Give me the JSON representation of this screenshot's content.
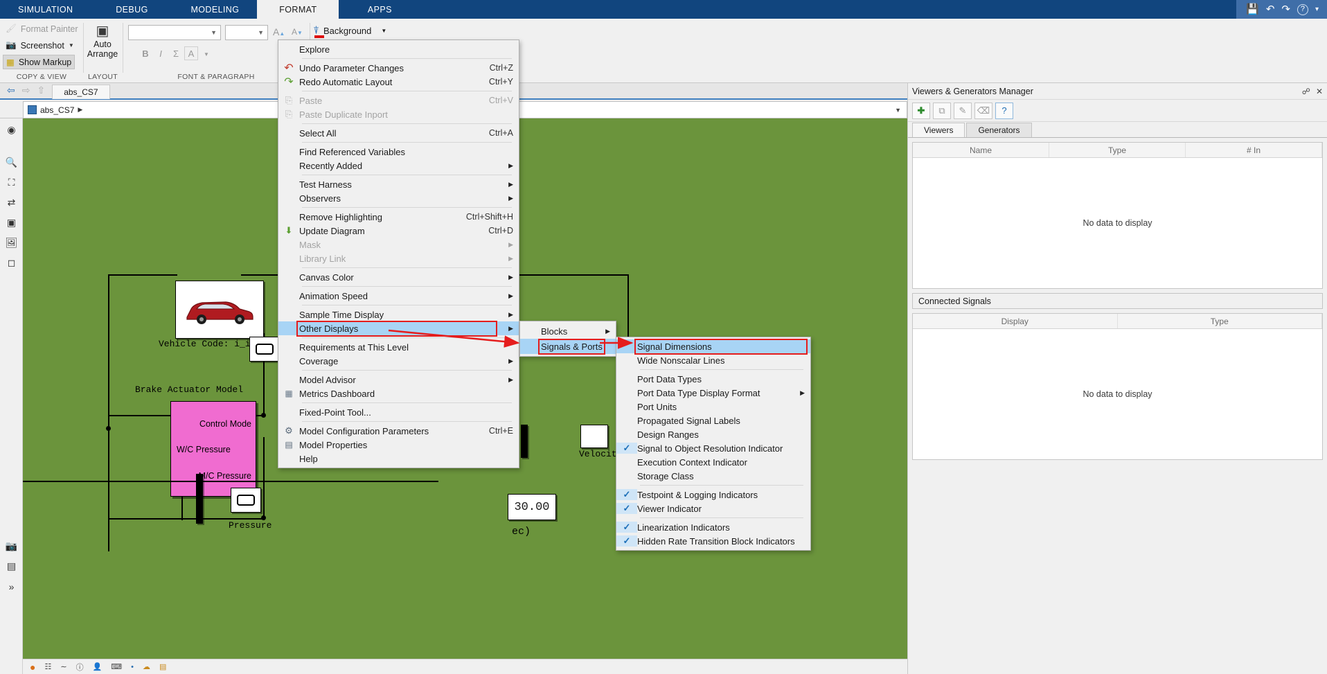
{
  "ribbon": {
    "tabs": [
      {
        "label": "SIMULATION",
        "active": false
      },
      {
        "label": "DEBUG",
        "active": false
      },
      {
        "label": "MODELING",
        "active": false
      },
      {
        "label": "FORMAT",
        "active": true
      },
      {
        "label": "APPS",
        "active": false
      }
    ],
    "quick_access": [
      {
        "name": "save-icon",
        "glyph": "💾"
      },
      {
        "name": "undo-icon",
        "glyph": "↶"
      },
      {
        "name": "redo-icon",
        "glyph": "↷"
      },
      {
        "name": "help-icon",
        "glyph": "?"
      },
      {
        "name": "chevron-down-icon",
        "glyph": "▾"
      }
    ],
    "groups": [
      {
        "name": "copy-and-view",
        "label": "COPY & VIEW",
        "items": [
          {
            "label": "Format Painter",
            "icon": "paintbrush-icon",
            "enabled": false
          },
          {
            "label": "Screenshot",
            "icon": "camera-icon",
            "enabled": true,
            "dropdown": true
          },
          {
            "label": "Show Markup",
            "icon": "markup-icon",
            "enabled": true,
            "pressed": true
          }
        ]
      },
      {
        "name": "layout",
        "label": "LAYOUT",
        "items": [
          {
            "label": "Auto\nArrange",
            "icon": "auto-arrange-icon",
            "enabled": true
          }
        ]
      },
      {
        "name": "font-and-paragraph",
        "label": "FONT & PARAGRAPH",
        "font_family_value": "",
        "font_size_value": "",
        "buttons": [
          "B",
          "I",
          "Σ",
          "A"
        ]
      }
    ],
    "background_label": "Background"
  },
  "model": {
    "tab_label": "abs_CS7",
    "breadcrumb": "abs_CS7",
    "canvas_color": "#6b943c",
    "labels": {
      "vehicle_code": "Vehicle Code: i_i",
      "brake_actuator": "Brake Actuator Model",
      "control_mode": "Control Mode",
      "wc_pressure": "W/C Pressure",
      "mc_pressure": "M/C Pressure",
      "pressure": "Pressure",
      "velocity": "Velocity",
      "display_value": "30.00",
      "time_units": "ec)"
    }
  },
  "context_menu": {
    "items": [
      {
        "label": "Explore",
        "icon": "",
        "accel": "",
        "enabled": true,
        "submenu": false,
        "separator_after": true
      },
      {
        "label": "Undo Parameter Changes",
        "icon": "undo-icon",
        "accel": "Ctrl+Z",
        "enabled": true,
        "submenu": false
      },
      {
        "label": "Redo Automatic Layout",
        "icon": "redo-icon",
        "accel": "Ctrl+Y",
        "enabled": true,
        "submenu": false,
        "separator_after": true
      },
      {
        "label": "Paste",
        "icon": "paste-icon",
        "accel": "Ctrl+V",
        "enabled": false,
        "submenu": false
      },
      {
        "label": "Paste Duplicate Inport",
        "icon": "paste-icon",
        "accel": "",
        "enabled": false,
        "submenu": false,
        "separator_after": true
      },
      {
        "label": "Select All",
        "icon": "",
        "accel": "Ctrl+A",
        "enabled": true,
        "submenu": false,
        "separator_after": true
      },
      {
        "label": "Find Referenced Variables",
        "icon": "",
        "accel": "",
        "enabled": true,
        "submenu": false
      },
      {
        "label": "Recently Added",
        "icon": "",
        "accel": "",
        "enabled": true,
        "submenu": true,
        "separator_after": true
      },
      {
        "label": "Test Harness",
        "icon": "",
        "accel": "",
        "enabled": true,
        "submenu": true
      },
      {
        "label": "Observers",
        "icon": "",
        "accel": "",
        "enabled": true,
        "submenu": true,
        "separator_after": true
      },
      {
        "label": "Remove Highlighting",
        "icon": "",
        "accel": "Ctrl+Shift+H",
        "enabled": true,
        "submenu": false
      },
      {
        "label": "Update Diagram",
        "icon": "update-diagram-icon",
        "accel": "Ctrl+D",
        "enabled": true,
        "submenu": false
      },
      {
        "label": "Mask",
        "icon": "",
        "accel": "",
        "enabled": false,
        "submenu": true
      },
      {
        "label": "Library Link",
        "icon": "",
        "accel": "",
        "enabled": false,
        "submenu": true,
        "separator_after": true
      },
      {
        "label": "Canvas Color",
        "icon": "",
        "accel": "",
        "enabled": true,
        "submenu": true,
        "separator_after": true
      },
      {
        "label": "Animation Speed",
        "icon": "",
        "accel": "",
        "enabled": true,
        "submenu": true,
        "separator_after": true
      },
      {
        "label": "Sample Time Display",
        "icon": "",
        "accel": "",
        "enabled": true,
        "submenu": true
      },
      {
        "label": "Other Displays",
        "icon": "",
        "accel": "",
        "enabled": true,
        "submenu": true,
        "selected": true,
        "highlight": true,
        "separator_after": true
      },
      {
        "label": "Requirements at This Level",
        "icon": "",
        "accel": "",
        "enabled": true,
        "submenu": false
      },
      {
        "label": "Coverage",
        "icon": "",
        "accel": "",
        "enabled": true,
        "submenu": true,
        "separator_after": true
      },
      {
        "label": "Model Advisor",
        "icon": "",
        "accel": "",
        "enabled": true,
        "submenu": true
      },
      {
        "label": "Metrics Dashboard",
        "icon": "dashboard-icon",
        "accel": "",
        "enabled": true,
        "submenu": false,
        "separator_after": true
      },
      {
        "label": "Fixed-Point Tool...",
        "icon": "",
        "accel": "",
        "enabled": true,
        "submenu": false,
        "separator_after": true
      },
      {
        "label": "Model Configuration Parameters",
        "icon": "gear-icon",
        "accel": "Ctrl+E",
        "enabled": true,
        "submenu": false
      },
      {
        "label": "Model Properties",
        "icon": "properties-icon",
        "accel": "",
        "enabled": true,
        "submenu": false
      },
      {
        "label": "Help",
        "icon": "",
        "accel": "",
        "enabled": true,
        "submenu": false
      }
    ]
  },
  "submenu_other_displays": {
    "items": [
      {
        "label": "Blocks",
        "submenu": true,
        "selected": false
      },
      {
        "label": "Signals & Ports",
        "submenu": true,
        "selected": true,
        "highlight": true
      }
    ]
  },
  "submenu_signals_ports": {
    "items": [
      {
        "label": "Signal Dimensions",
        "checked": false,
        "submenu": false,
        "selected": true,
        "highlight": true
      },
      {
        "label": "Wide Nonscalar Lines",
        "checked": false,
        "submenu": false,
        "separator_after": true
      },
      {
        "label": "Port Data Types",
        "checked": false,
        "submenu": false
      },
      {
        "label": "Port Data Type Display Format",
        "checked": false,
        "submenu": true
      },
      {
        "label": "Port Units",
        "checked": false,
        "submenu": false
      },
      {
        "label": "Propagated Signal Labels",
        "checked": false,
        "submenu": false
      },
      {
        "label": "Design Ranges",
        "checked": false,
        "submenu": false
      },
      {
        "label": "Signal to Object Resolution Indicator",
        "checked": true,
        "submenu": false
      },
      {
        "label": "Execution Context Indicator",
        "checked": false,
        "submenu": false
      },
      {
        "label": "Storage Class",
        "checked": false,
        "submenu": false,
        "separator_after": true
      },
      {
        "label": "Testpoint & Logging Indicators",
        "checked": true,
        "submenu": false
      },
      {
        "label": "Viewer Indicator",
        "checked": true,
        "submenu": false,
        "separator_after": true
      },
      {
        "label": "Linearization Indicators",
        "checked": true,
        "submenu": false
      },
      {
        "label": "Hidden Rate Transition Block Indicators",
        "checked": true,
        "submenu": false
      }
    ]
  },
  "right_panel": {
    "title": "Viewers & Generators Manager",
    "title_icons": [
      {
        "name": "pin-icon",
        "glyph": "⚑"
      },
      {
        "name": "close-icon",
        "glyph": "✕"
      }
    ],
    "toolbar_buttons": [
      {
        "name": "add-button",
        "glyph": "✚"
      },
      {
        "name": "copy-button",
        "glyph": "⧉"
      },
      {
        "name": "edit-button",
        "glyph": "✎"
      },
      {
        "name": "delete-button",
        "glyph": "⌫"
      },
      {
        "name": "help-button",
        "glyph": "?"
      }
    ],
    "tabs": [
      {
        "label": "Viewers",
        "active": true
      },
      {
        "label": "Generators",
        "active": false
      }
    ],
    "viewers_columns": [
      "Name",
      "Type",
      "# In"
    ],
    "viewers_empty_text": "No data to display",
    "connected_signals_title": "Connected Signals",
    "connected_columns": [
      "Display",
      "Type"
    ],
    "connected_empty_text": "No data to display"
  },
  "colors": {
    "ribbon_blue": "#11457e",
    "canvas_green": "#6b943c",
    "menu_bg": "#f0f0f0",
    "selection_blue": "#a8d4f5",
    "highlight_red": "#e51d1d",
    "block_pink": "#f06cd0"
  }
}
